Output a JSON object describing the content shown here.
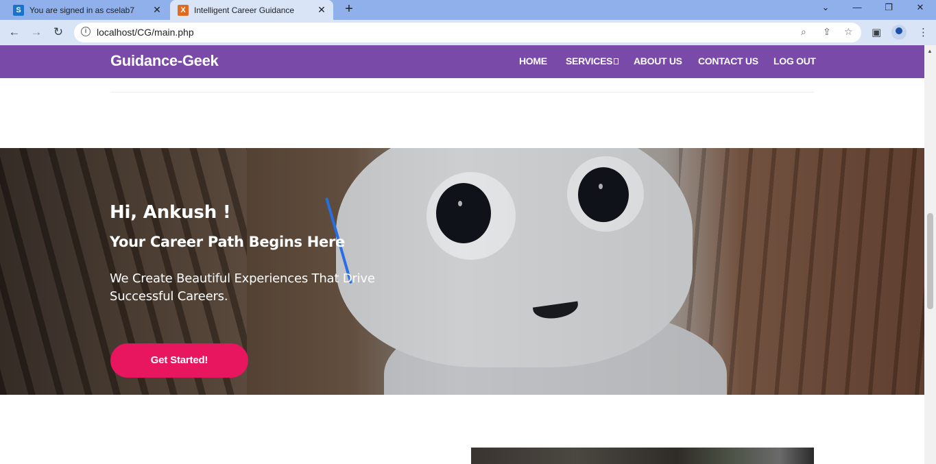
{
  "browser": {
    "tabs": [
      {
        "title": "You are signed in as cselab7",
        "favicon": "S",
        "active": false
      },
      {
        "title": "Intelligent Career Guidance",
        "favicon": "X",
        "active": true
      }
    ],
    "new_tab_icon": "+",
    "url": "localhost/CG/main.php"
  },
  "site": {
    "brand": "Guidance-Geek",
    "nav": {
      "home": "HOME",
      "services": "SERVICES",
      "about": "ABOUT US",
      "contact": "CONTACT US",
      "logout": "LOG OUT"
    }
  },
  "hero": {
    "greeting": "Hi, Ankush !",
    "title": "Your Career Path Begins Here",
    "subtitle": "We Create Beautiful Experiences That Drive Successful Careers.",
    "cta_label": "Get Started!"
  },
  "colors": {
    "navbar": "#7a4aa8",
    "cta": "#e8155f",
    "tabstrip": "#8fb0ea"
  }
}
